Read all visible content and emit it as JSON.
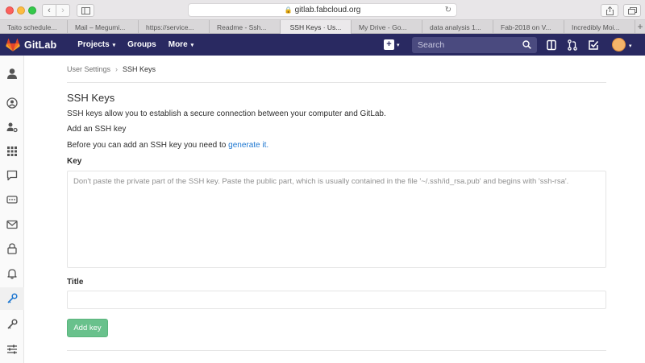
{
  "browser": {
    "url": "gitlab.fabcloud.org",
    "tabs": [
      {
        "label": "Taito schedule..."
      },
      {
        "label": "Mail – Megumi..."
      },
      {
        "label": "https://service..."
      },
      {
        "label": "Readme - Ssh..."
      },
      {
        "label": "SSH Keys · Us...",
        "active": true
      },
      {
        "label": "My Drive - Go..."
      },
      {
        "label": "data analysis 1..."
      },
      {
        "label": "Fab-2018 on V..."
      },
      {
        "label": "Incredibly Moi..."
      }
    ],
    "new_tab_label": "+"
  },
  "header": {
    "brand": "GitLab",
    "nav": [
      {
        "label": "Projects",
        "caret": "▾"
      },
      {
        "label": "Groups"
      },
      {
        "label": "More",
        "caret": "▾"
      }
    ],
    "search_placeholder": "Search",
    "colors": {
      "bg": "#292961",
      "logo": "#e24329"
    }
  },
  "breadcrumb": {
    "parent": "User Settings",
    "separator": "›",
    "current": "SSH Keys"
  },
  "main": {
    "title": "SSH Keys",
    "description": "SSH keys allow you to establish a secure connection between your computer and GitLab.",
    "add_heading": "Add an SSH key",
    "before_text": "Before you can add an SSH key you need to ",
    "generate_link": "generate it.",
    "key_label": "Key",
    "key_placeholder": "Don't paste the private part of the SSH key. Paste the public part, which is usually contained in the file '~/.ssh/id_rsa.pub' and begins with 'ssh-rsa'.",
    "title_label": "Title",
    "add_button": "Add key",
    "colors": {
      "button": "#69c18c",
      "link": "#1f78d1"
    }
  }
}
